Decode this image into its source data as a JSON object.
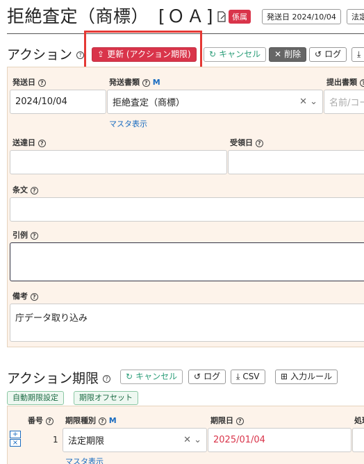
{
  "header": {
    "title": "拒絶査定（商標）",
    "oa": "[ＯＡ]",
    "status_badge": "係属",
    "sent_date_chip": "発送日 2024/10/04",
    "law_chip": "法定"
  },
  "action": {
    "title": "アクション",
    "buttons": {
      "update": "更新 (アクション期限)",
      "cancel": "キャンセル",
      "delete": "削除",
      "log": "ログ"
    },
    "fields": {
      "sent_date_label": "発送日",
      "sent_date_value": "2024/10/04",
      "doc_type_label": "発送書類",
      "doc_type_value": "拒絶査定（商標）",
      "master_link": "マスタ表示",
      "m_mark": "M",
      "submit_doc_label": "提出書類",
      "submit_doc_placeholder": "名前/コード",
      "delivery_date_label": "送達日",
      "received_date_label": "受領日",
      "article_label": "条文",
      "citation_label": "引例",
      "remarks_label": "備考",
      "remarks_value": "庁データ取り込み"
    }
  },
  "deadline": {
    "title": "アクション期限",
    "buttons": {
      "cancel": "キャンセル",
      "log": "ログ",
      "csv": "CSV",
      "input_rule": "入力ルール",
      "auto_setting": "自動期限設定",
      "offset": "期限オフセット"
    },
    "columns": {
      "number": "番号",
      "type": "期限種別",
      "m_mark": "M",
      "date": "期限日",
      "handling": "処理"
    },
    "row": {
      "number": "1",
      "type": "法定期限",
      "date": "2025/01/04",
      "master_link": "マスタ表示"
    }
  },
  "colors": {
    "accent_red": "#d9344a",
    "panel_bg": "#fdf3ea",
    "link_blue": "#1a6cc0",
    "cancel_green": "#2a9d78"
  }
}
